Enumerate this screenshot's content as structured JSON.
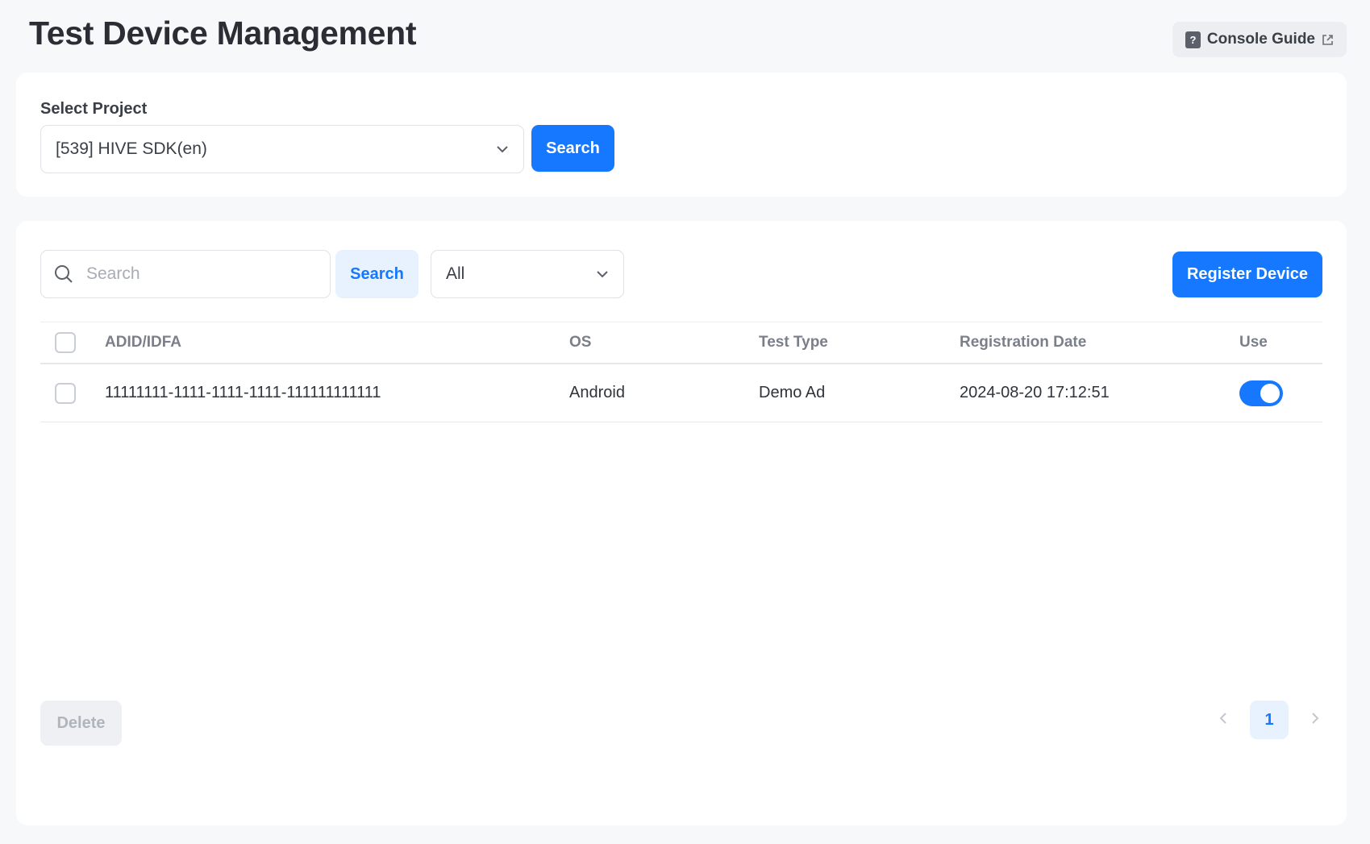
{
  "header": {
    "title": "Test Device Management",
    "guide_label": "Console Guide",
    "guide_icon": "help-doc-icon",
    "external_icon": "external-link-icon"
  },
  "project": {
    "label": "Select Project",
    "selected": "[539] HIVE SDK(en)",
    "search_label": "Search"
  },
  "list": {
    "search_placeholder": "Search",
    "search_value": "",
    "search_label": "Search",
    "filter_selected": "All",
    "register_label": "Register Device",
    "columns": [
      "ADID/IDFA",
      "OS",
      "Test Type",
      "Registration Date",
      "Use"
    ],
    "rows": [
      {
        "adid": "11111111-1111-1111-1111-111111111111",
        "os": "Android",
        "test_type": "Demo Ad",
        "date": "2024-08-20 17:12:51",
        "use": true
      }
    ],
    "delete_label": "Delete",
    "current_page": "1"
  },
  "colors": {
    "primary": "#1677ff",
    "primary_light": "#e8f1fe",
    "background": "#f7f8fa"
  }
}
